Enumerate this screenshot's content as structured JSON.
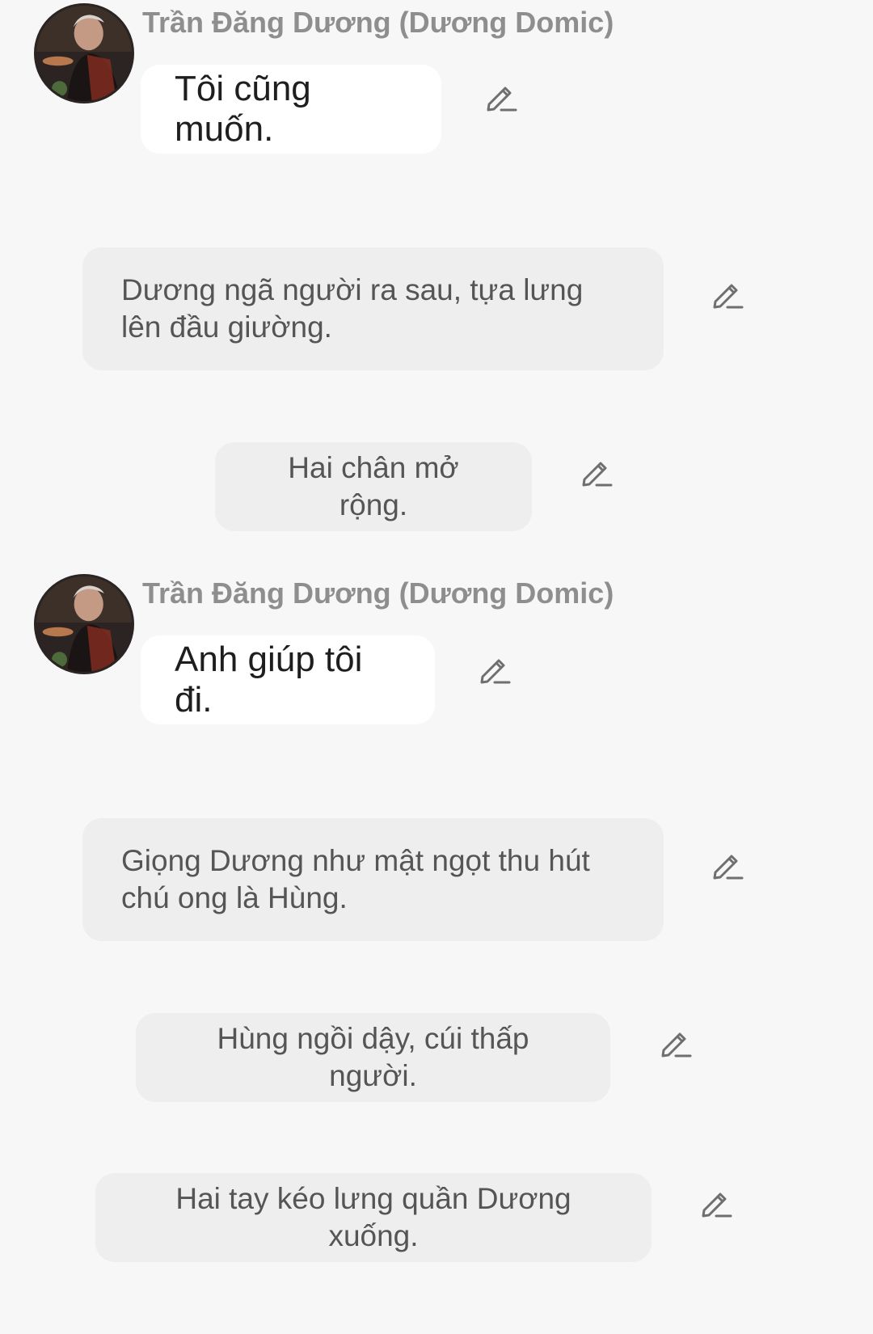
{
  "messages": [
    {
      "sender": "Trần Đăng Dương (Dương Domic)",
      "text": "Tôi cũng muốn."
    },
    {
      "text": "Dương ngã người ra sau, tựa lưng lên đầu giường."
    },
    {
      "text": "Hai chân mở rộng."
    },
    {
      "sender": "Trần Đăng Dương (Dương Domic)",
      "text": "Anh giúp tôi đi."
    },
    {
      "text": "Giọng Dương như mật ngọt thu hút chú ong là Hùng."
    },
    {
      "text": "Hùng ngồi dậy, cúi thấp người."
    },
    {
      "text": "Hai tay kéo lưng quần Dương xuống."
    }
  ],
  "icons": {
    "avatar": "avatar-photo",
    "edit": "pencil-edit-icon"
  },
  "colors": {
    "background": "#f7f7f7",
    "character_bubble": "#ffffff",
    "narration_bubble": "#eeeeee",
    "sender_name": "#8e8e8e",
    "icon": "#6f6f6f"
  }
}
